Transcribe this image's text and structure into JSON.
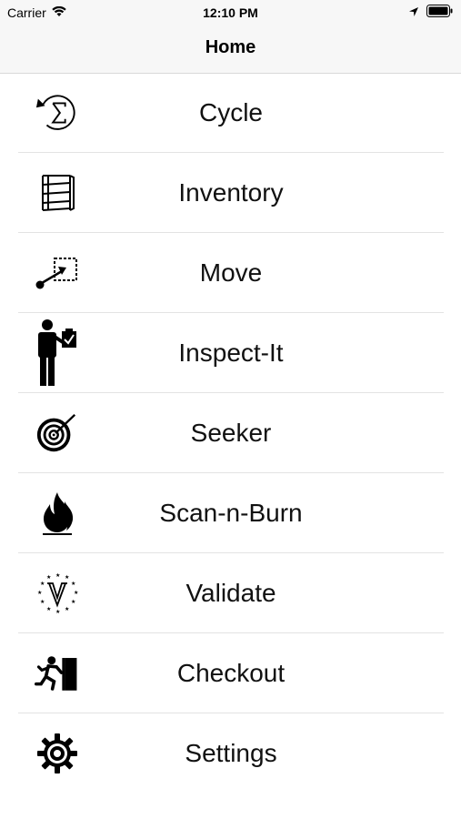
{
  "status_bar": {
    "carrier": "Carrier",
    "time": "12:10 PM"
  },
  "nav": {
    "title": "Home"
  },
  "menu": {
    "items": [
      {
        "label": "Cycle",
        "icon": "cycle-sigma-icon"
      },
      {
        "label": "Inventory",
        "icon": "shelving-icon"
      },
      {
        "label": "Move",
        "icon": "move-icon"
      },
      {
        "label": "Inspect-It",
        "icon": "inspector-clipboard-icon"
      },
      {
        "label": "Seeker",
        "icon": "target-icon"
      },
      {
        "label": "Scan-n-Burn",
        "icon": "flame-icon"
      },
      {
        "label": "Validate",
        "icon": "validate-v-icon"
      },
      {
        "label": "Checkout",
        "icon": "exit-running-person-icon"
      },
      {
        "label": "Settings",
        "icon": "gear-icon"
      }
    ]
  }
}
